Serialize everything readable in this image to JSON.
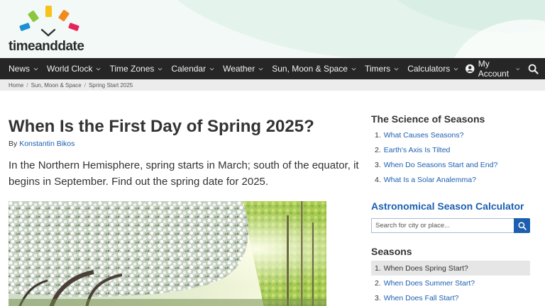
{
  "brand": {
    "name": "timeanddate"
  },
  "nav": {
    "items": [
      {
        "label": "News"
      },
      {
        "label": "World Clock"
      },
      {
        "label": "Time Zones"
      },
      {
        "label": "Calendar"
      },
      {
        "label": "Weather"
      },
      {
        "label": "Sun, Moon & Space"
      },
      {
        "label": "Timers"
      },
      {
        "label": "Calculators"
      }
    ],
    "account_label": "My Account"
  },
  "breadcrumb": [
    "Home",
    "Sun, Moon & Space",
    "Spring Start 2025"
  ],
  "article": {
    "title": "When Is the First Day of Spring 2025?",
    "byline_prefix": "By",
    "author": "Konstantin Bikos",
    "intro": "In the Northern Hemisphere, spring starts in March; south of the equator, it begins in September. Find out the spring date for 2025."
  },
  "sidebar": {
    "science": {
      "heading": "The Science of Seasons",
      "items": [
        {
          "num": "1.",
          "label": "What Causes Seasons?"
        },
        {
          "num": "2.",
          "label": "Earth's Axis Is Tilted"
        },
        {
          "num": "3.",
          "label": "When Do Seasons Start and End?"
        },
        {
          "num": "4.",
          "label": "What Is a Solar Analemma?"
        }
      ]
    },
    "calculator": {
      "heading": "Astronomical Season Calculator",
      "placeholder": "Search for city or place..."
    },
    "seasons": {
      "heading": "Seasons",
      "items": [
        {
          "num": "1.",
          "label": "When Does Spring Start?",
          "active": true
        },
        {
          "num": "2.",
          "label": "When Does Summer Start?"
        },
        {
          "num": "3.",
          "label": "When Does Fall Start?"
        }
      ]
    }
  },
  "colors": {
    "nav_bg": "#262626",
    "link": "#1c5fb0",
    "header_bg": "#f2f9f6"
  }
}
